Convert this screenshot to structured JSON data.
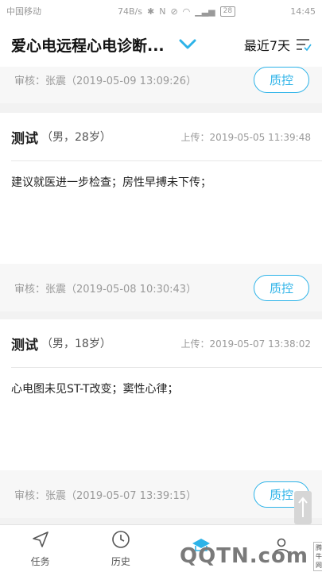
{
  "status_bar": {
    "carrier": "中国移动",
    "speed": "74B/s",
    "battery": "28",
    "time": "14:45"
  },
  "header": {
    "title": "爱心电远程心电诊断...",
    "range_label": "最近7天"
  },
  "records": [
    {
      "reviewer": "审核：张震（2019-05-09 13:09:26）",
      "qc_label": "质控"
    },
    {
      "name": "测试",
      "meta": "（男，28岁）",
      "upload": "上传：2019-05-05 11:39:48",
      "diagnosis": "建议就医进一步检查；房性早搏未下传；",
      "reviewer": "审核：张震（2019-05-08 10:30:43）",
      "qc_label": "质控"
    },
    {
      "name": "测试",
      "meta": "（男，18岁）",
      "upload": "上传：2019-05-07 13:38:02",
      "diagnosis": "心电图未见ST-T改变；窦性心律；",
      "reviewer": "审核：张震（2019-05-07 13:39:15）",
      "qc_label": "质控"
    }
  ],
  "tabs": [
    {
      "label": "任务",
      "icon": "send-icon"
    },
    {
      "label": "历史",
      "icon": "clock-icon"
    },
    {
      "label": "",
      "icon": "stats-icon"
    },
    {
      "label": "",
      "icon": "user-icon"
    }
  ],
  "watermark": {
    "site": "腾牛网",
    "text": "QQTN.com"
  },
  "colors": {
    "accent": "#2db3e8",
    "background": "#f2f2f2"
  }
}
